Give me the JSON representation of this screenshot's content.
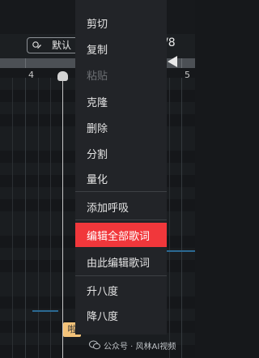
{
  "header": {
    "preset_label": "默认",
    "time_signature_fragment": "/8"
  },
  "ruler": {
    "bar_numbers": [
      "4",
      "5"
    ]
  },
  "editor": {
    "lyric_note_text": "啦"
  },
  "context_menu": {
    "items": [
      {
        "label": "剪切",
        "enabled": true,
        "highlighted": false
      },
      {
        "label": "复制",
        "enabled": true,
        "highlighted": false
      },
      {
        "label": "粘贴",
        "enabled": false,
        "highlighted": false
      },
      {
        "label": "克隆",
        "enabled": true,
        "highlighted": false
      },
      {
        "label": "删除",
        "enabled": true,
        "highlighted": false
      },
      {
        "label": "分割",
        "enabled": true,
        "highlighted": false
      },
      {
        "label": "量化",
        "enabled": true,
        "highlighted": false
      },
      {
        "label": "添加呼吸",
        "enabled": true,
        "highlighted": false
      },
      {
        "label": "编辑全部歌词",
        "enabled": true,
        "highlighted": true
      },
      {
        "label": "由此编辑歌词",
        "enabled": true,
        "highlighted": false
      },
      {
        "label": "升八度",
        "enabled": true,
        "highlighted": false
      },
      {
        "label": "降八度",
        "enabled": true,
        "highlighted": false
      }
    ]
  },
  "watermark": {
    "text": "公众号 · 风林AI视频"
  },
  "colors": {
    "menu_bg": "#222428",
    "highlight": "#f1373b",
    "lyric_note": "#f3c37a",
    "note_line": "#2b6a93"
  },
  "icons": [
    "preset-pen-icon",
    "wechat-icon"
  ]
}
